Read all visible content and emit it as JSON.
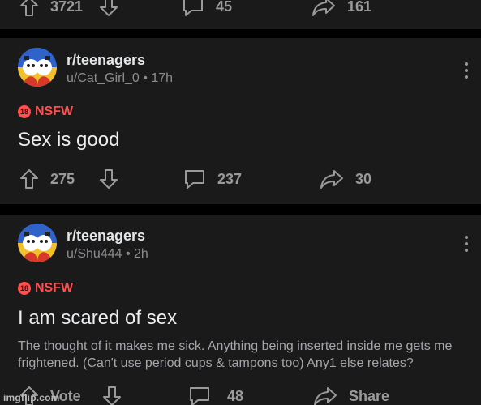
{
  "top_card": {
    "upvotes": "3721",
    "comments": "45",
    "shares": "161"
  },
  "posts": [
    {
      "subreddit": "r/teenagers",
      "meta": "u/Cat_Girl_0 • 17h",
      "nsfw_label": "NSFW",
      "nsfw_badge": "18",
      "title": "Sex is good",
      "body": "",
      "votes": "275",
      "comments": "237",
      "shares": "30"
    },
    {
      "subreddit": "r/teenagers",
      "meta": "u/Shu444 • 2h",
      "nsfw_label": "NSFW",
      "nsfw_badge": "18",
      "title": "I am scared of sex",
      "body": "The thought of it makes me sick. Anything being inserted inside me gets me frightened. (Can't use period cups & tampons too) Any1 else relates?",
      "votes": "Vote",
      "comments": "48",
      "shares": "Share"
    }
  ],
  "watermark": "imgflip.com",
  "colors": {
    "background": "#000000",
    "card": "#1a1a1b",
    "nsfw": "#ff4f4f",
    "icon": "#9a9a9a"
  }
}
